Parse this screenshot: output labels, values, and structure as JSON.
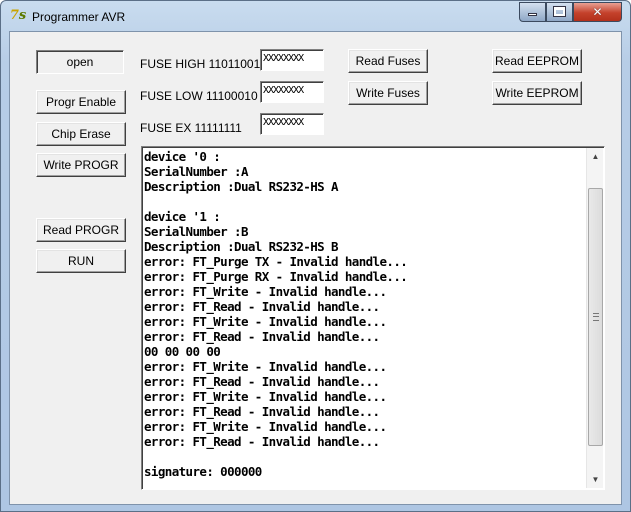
{
  "window": {
    "title": "Programmer AVR",
    "icon": "delphi-app-icon",
    "controls": {
      "minimize": "minimize-icon",
      "maximize": "maximize-icon",
      "close": "close-icon"
    }
  },
  "buttons": {
    "open": "open",
    "progr_enable": "Progr Enable",
    "chip_erase": "Chip Erase",
    "write_progr": "Write PROGR",
    "read_progr": "Read PROGR",
    "run": "RUN",
    "read_fuses": "Read Fuses",
    "write_fuses": "Write Fuses",
    "read_eeprom": "Read EEPROM",
    "write_eeprom": "Write EEPROM"
  },
  "fuses": {
    "high": {
      "label": "FUSE HIGH 11011001",
      "value": "XXXXXXXX"
    },
    "low": {
      "label": "FUSE LOW 11100010",
      "value": "XXXXXXXX"
    },
    "ex": {
      "label": "FUSE EX 11111111",
      "value": "XXXXXXXX"
    }
  },
  "log": [
    "device '0 :",
    "SerialNumber :A",
    "Description :Dual RS232-HS A",
    "",
    "device '1 :",
    "SerialNumber :B",
    "Description :Dual RS232-HS B",
    "error: FT_Purge TX - Invalid handle...",
    "error: FT_Purge RX - Invalid handle...",
    "error: FT_Write - Invalid handle...",
    "error: FT_Read - Invalid handle...",
    "error: FT_Write - Invalid handle...",
    "error: FT_Read - Invalid handle...",
    "00 00 00 00",
    "error: FT_Write - Invalid handle...",
    "error: FT_Read - Invalid handle...",
    "error: FT_Write - Invalid handle...",
    "error: FT_Read - Invalid handle...",
    "error: FT_Write - Invalid handle...",
    "error: FT_Read - Invalid handle...",
    "",
    "signature: 000000"
  ]
}
